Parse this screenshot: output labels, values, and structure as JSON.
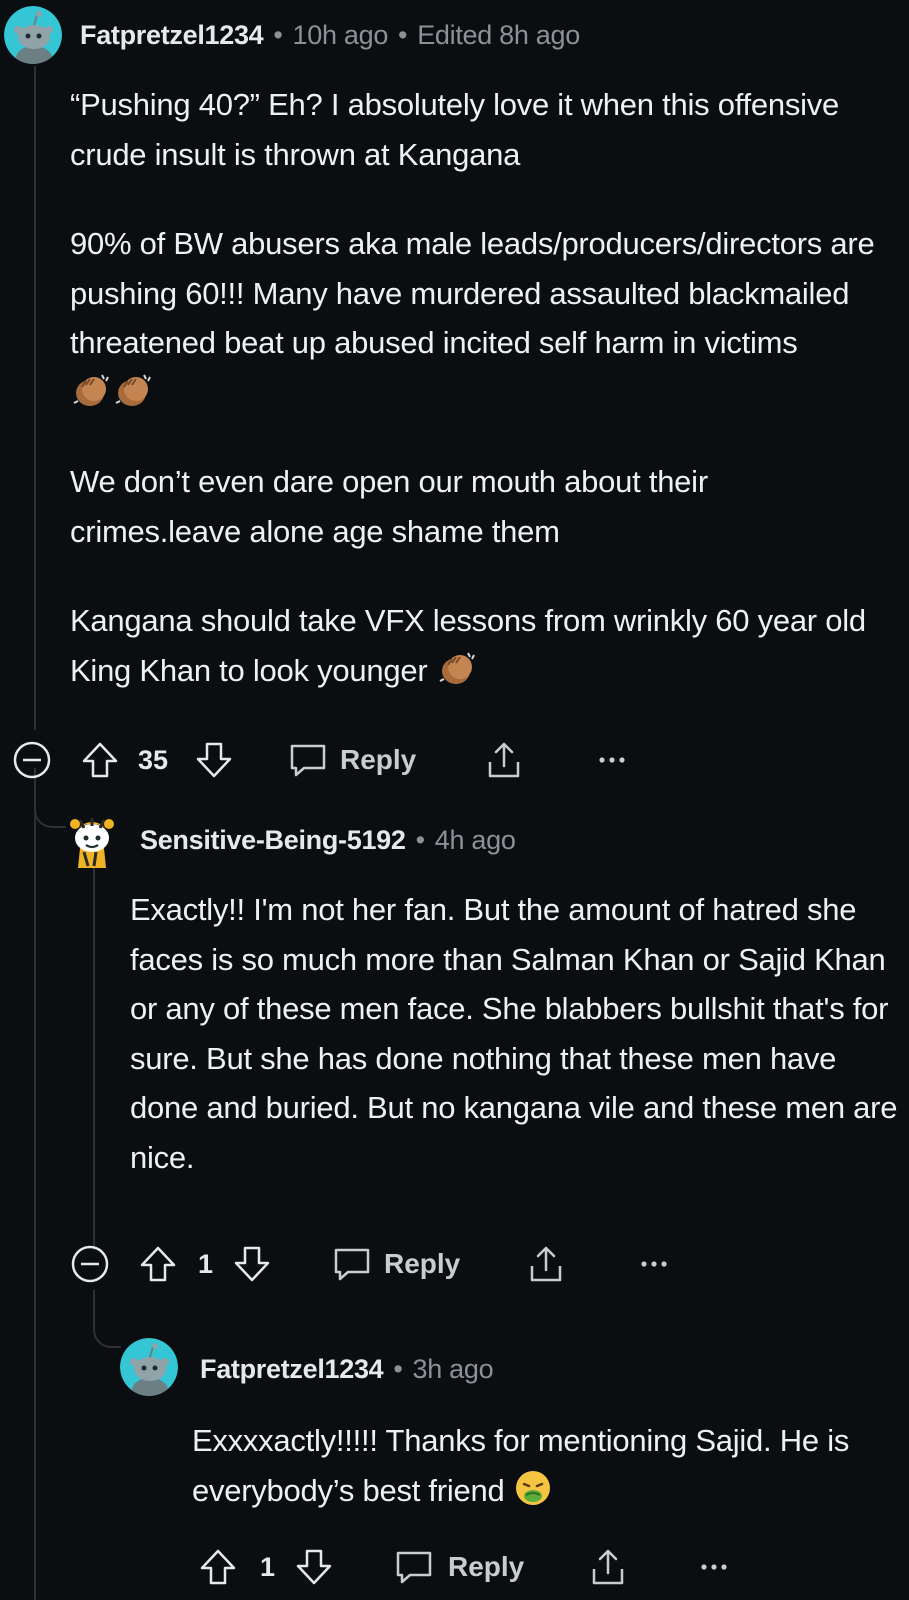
{
  "comments": [
    {
      "username": "Fatpretzel1234",
      "time": "10h ago",
      "edited": "Edited 8h ago",
      "paragraphs": [
        "“Pushing 40?” Eh? I absolutely love it when this offensive crude insult is thrown at Kangana",
        "90% of BW abusers aka male leads/producers/directors are pushing 60!!! Many have murdered assaulted blackmailed threatened beat up abused incited self harm in victims",
        "We don’t even dare open our mouth about their crimes.leave alone age shame them",
        "Kangana should take VFX lessons from wrinkly 60 year old King Khan to look younger"
      ],
      "emojis": {
        "p1": "clapping-hands",
        "p3": "clapping-hands"
      },
      "votes": "35",
      "reply_label": "Reply"
    },
    {
      "username": "Sensitive-Being-5192",
      "time": "4h ago",
      "paragraphs": [
        "Exactly!! I'm not her fan. But the amount of hatred she faces is so much more than Salman Khan or Sajid Khan or any of these men face. She blabbers bullshit that's for sure. But she has done nothing that these men have done and buried. But no kangana vile and these men are nice."
      ],
      "votes": "1",
      "reply_label": "Reply"
    },
    {
      "username": "Fatpretzel1234",
      "time": "3h ago",
      "paragraphs": [
        "Exxxxactly!!!!! Thanks for mentioning Sajid. He is everybody’s best friend"
      ],
      "emojis": {
        "p0": "nauseated-face"
      },
      "votes": "1",
      "reply_label": "Reply"
    }
  ],
  "colors": {
    "background": "#0b0e11",
    "text": "#eef0f2",
    "muted": "#8b9196",
    "avatar_teal": "#34c6d5",
    "thread_line": "#2c3136"
  },
  "separator": "•"
}
